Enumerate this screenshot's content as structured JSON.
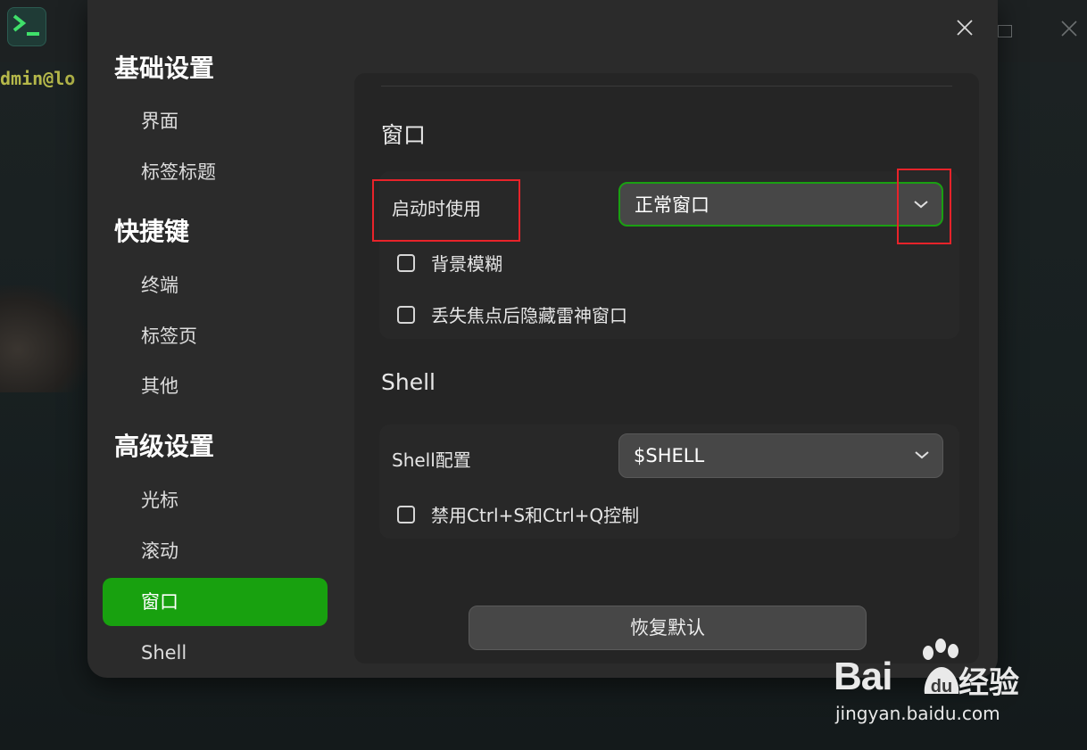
{
  "terminal": {
    "prompt_text": "dmin@lo"
  },
  "sidebar": {
    "sections": [
      {
        "title": "基础设置",
        "items": [
          "界面",
          "标签标题"
        ]
      },
      {
        "title": "快捷键",
        "items": [
          "终端",
          "标签页",
          "其他"
        ]
      },
      {
        "title": "高级设置",
        "items": [
          "光标",
          "滚动",
          "窗口",
          "Shell"
        ]
      }
    ],
    "active_item": "窗口"
  },
  "window_group": {
    "title": "窗口",
    "startup_label": "启动时使用",
    "startup_value": "正常窗口",
    "bg_blur_label": "背景模糊",
    "hide_on_blur_label": "丢失焦点后隐藏雷神窗口"
  },
  "shell_group": {
    "title": "Shell",
    "config_label": "Shell配置",
    "config_value": "$SHELL",
    "disable_ctrl_label": "禁用Ctrl+S和Ctrl+Q控制"
  },
  "reset_label": "恢复默认",
  "watermark": {
    "bai": "Bai",
    "du": "du",
    "jingyan": "经验",
    "url": "jingyan.baidu.com"
  },
  "colors": {
    "accent": "#18a10f",
    "annotation": "#e8232a"
  }
}
